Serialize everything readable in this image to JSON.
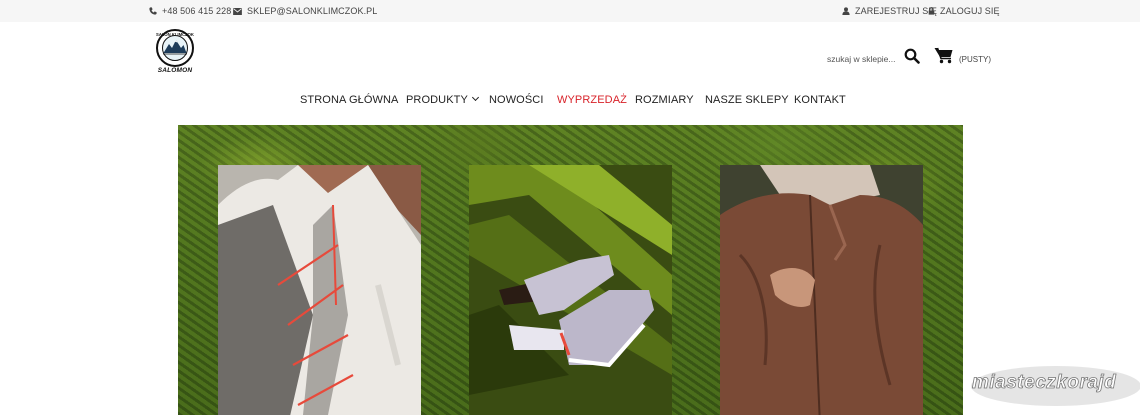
{
  "topbar": {
    "phone": "+48 506 415 228",
    "email": "SKLEP@SALONKLIMCZOK.PL",
    "register": "ZAREJESTRUJ SIĘ",
    "login": "ZALOGUJ SIĘ",
    "icons": [
      "phone-icon",
      "envelope-icon",
      "user-icon",
      "lock-icon"
    ]
  },
  "header": {
    "logo_ring_text": "SALON KLIMCZOK",
    "logo_brand": "SALOMON",
    "search_placeholder": "szukaj w sklepie...",
    "cart_label": "(PUSTY)"
  },
  "nav": {
    "items": [
      {
        "label": "STRONA GŁÓWNA"
      },
      {
        "label": "PRODUKTY"
      },
      {
        "label": "NOWOŚCI"
      },
      {
        "label": "WYPRZEDAŻ"
      },
      {
        "label": "ROZMIARY"
      },
      {
        "label": "NASZE SKLEPY"
      },
      {
        "label": "KONTAKT"
      }
    ],
    "sale_color": "#d8232a"
  },
  "hero": {
    "panels": [
      "running vest",
      "running shoes",
      "brown jacket"
    ]
  },
  "watermark": "miasteczkorajd"
}
